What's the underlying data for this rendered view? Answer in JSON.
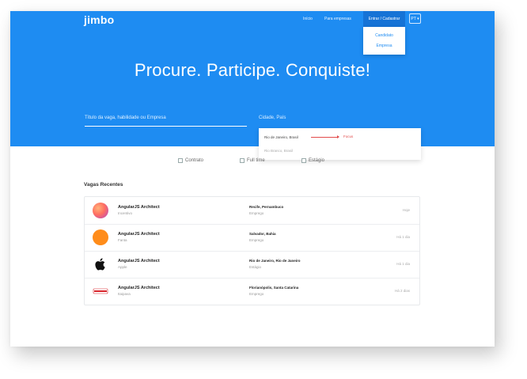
{
  "header": {
    "logo_text": "jimbo",
    "nav": {
      "inicio": "Início",
      "para_empresas": "Para empresas",
      "enter": "Entrar / Cadastrar",
      "lang": "PT ▾"
    },
    "dropdown": {
      "candidato": "Candidato",
      "empresa": "Empresa"
    }
  },
  "hero": {
    "headline": "Procure. Participe. Conquiste!",
    "search_keywords_placeholder": "Título da vaga, habilidade ou Empresa",
    "search_location_placeholder": "Cidade, País"
  },
  "autocomplete": {
    "items": [
      "Rio de Janeiro, Brasil",
      "Rio Branco, Brasil"
    ],
    "focus_tag": "Focus"
  },
  "filters": [
    "Contrato",
    "Full time",
    "Estágio"
  ],
  "recent": {
    "title": "Vagas Recentes",
    "jobs": [
      {
        "title": "AngularJS Architect",
        "company": "Incentivo",
        "location": "Recife, Pernambuco",
        "type": "Emprego",
        "time": "Hoje",
        "logo": "ionic-logo"
      },
      {
        "title": "AngularJS Architect",
        "company": "Fanta",
        "location": "Salvador, Bahia",
        "type": "Emprego",
        "time": "Há 1 dia",
        "logo": "fanta-logo"
      },
      {
        "title": "AngularJS Architect",
        "company": "Apple",
        "location": "Rio de Janeiro, Rio de Janeiro",
        "type": "Estágio",
        "time": "Há 1 dia",
        "logo": "apple-logo"
      },
      {
        "title": "AngularJS Architect",
        "company": "Itaipava",
        "location": "Florianópolis, Santa Catarina",
        "type": "Emprego",
        "time": "Há 2 dias",
        "logo": "itaipava-logo"
      }
    ]
  },
  "colors": {
    "brand_blue": "#1e8cf2",
    "accent_yellow": "#ffd23f",
    "focus_red": "#e24b4b"
  }
}
